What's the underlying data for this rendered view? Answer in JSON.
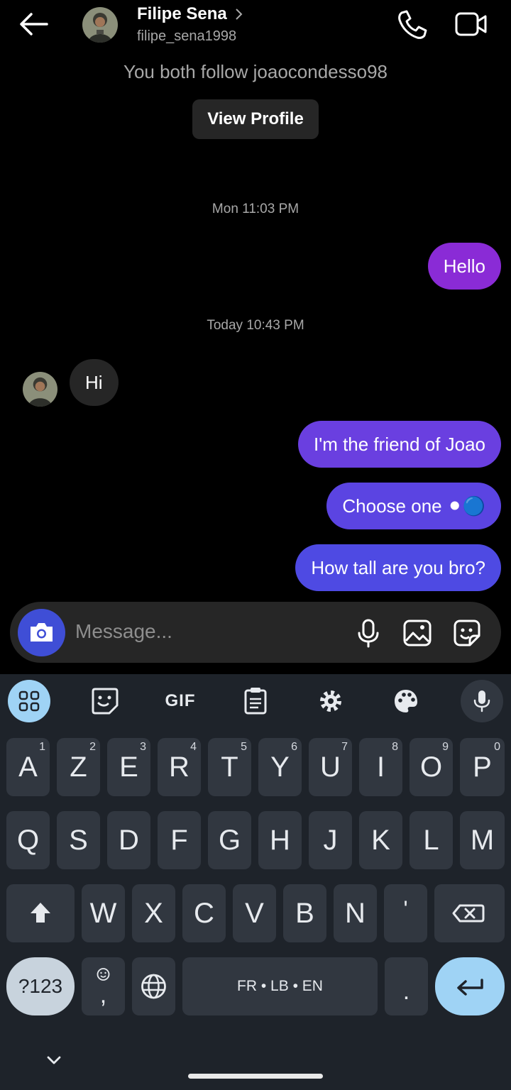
{
  "header": {
    "name": "Filipe Sena",
    "username": "filipe_sena1998",
    "mutual": "You both follow joaocondesso98",
    "view_profile": "View Profile"
  },
  "messages": {
    "ts1": "Mon 11:03 PM",
    "m1": "Hello",
    "ts2": "Today 10:43 PM",
    "m2": "Hi",
    "m3": "I'm the friend of Joao",
    "m4": "Choose one ⚫🔵",
    "m5": "How tall are you bro?"
  },
  "composer": {
    "placeholder": "Message..."
  },
  "keyboard": {
    "row1": [
      {
        "l": "A",
        "n": "1"
      },
      {
        "l": "Z",
        "n": "2"
      },
      {
        "l": "E",
        "n": "3"
      },
      {
        "l": "R",
        "n": "4"
      },
      {
        "l": "T",
        "n": "5"
      },
      {
        "l": "Y",
        "n": "6"
      },
      {
        "l": "U",
        "n": "7"
      },
      {
        "l": "I",
        "n": "8"
      },
      {
        "l": "O",
        "n": "9"
      },
      {
        "l": "P",
        "n": "0"
      }
    ],
    "row2": [
      "Q",
      "S",
      "D",
      "F",
      "G",
      "H",
      "J",
      "K",
      "L",
      "M"
    ],
    "row3": [
      "W",
      "X",
      "C",
      "V",
      "B",
      "N",
      "'"
    ],
    "gif": "GIF",
    "symbols": "?123",
    "comma": ",",
    "space": "FR • LB • EN",
    "period": "."
  },
  "colors": {
    "bubble_hello": "#8a2bd6",
    "bubble_joao": "#6a3fe0",
    "bubble_choose": "#5b44e2",
    "bubble_tall": "#4e4ae3",
    "camera": "#3f4ed6",
    "enter": "#9fd3f5"
  }
}
